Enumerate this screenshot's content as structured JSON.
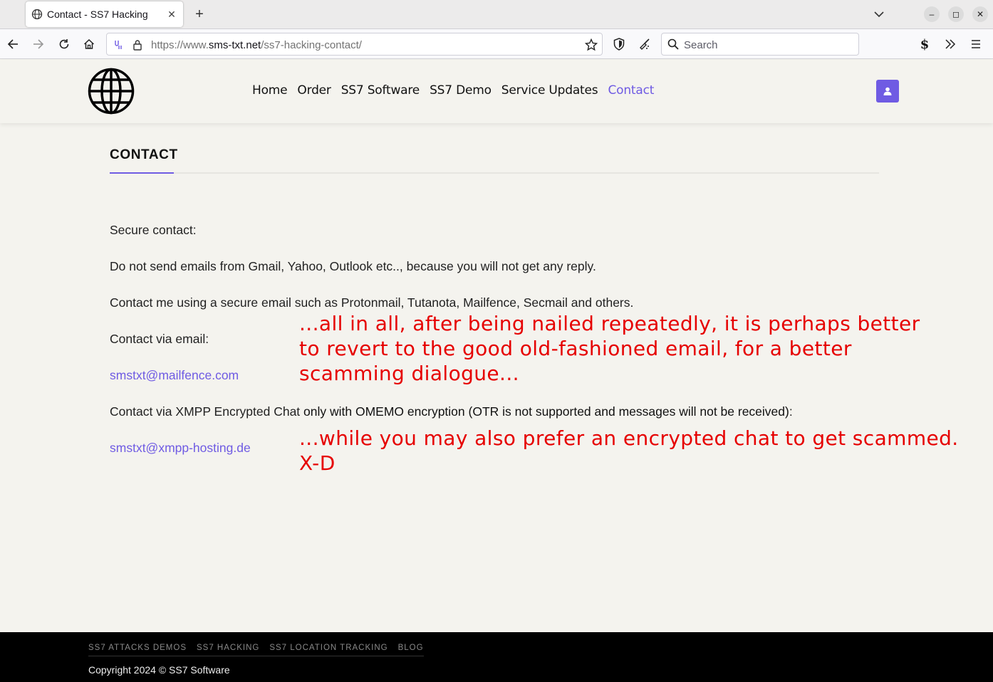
{
  "browser": {
    "tab_title": "Contact - SS7 Hacking",
    "url_prefix": "https://www.",
    "url_host": "sms-txt.net",
    "url_path": "/ss7-hacking-contact/",
    "search_placeholder": "Search",
    "icons": [
      "globe-icon",
      "close-icon",
      "plus-icon",
      "chevron-down-icon",
      "minimize-icon",
      "maximize-icon",
      "window-close-icon",
      "back-icon",
      "forward-icon",
      "reload-icon",
      "home-icon",
      "tracking-icon",
      "lock-icon",
      "star-icon",
      "shield-icon",
      "broom-icon",
      "search-icon",
      "s-extension-icon",
      "overflow-icon",
      "hamburger-icon"
    ]
  },
  "site": {
    "nav": [
      "Home",
      "Order",
      "SS7 Software",
      "SS7 Demo",
      "Service Updates",
      "Contact"
    ],
    "active_nav": "Contact",
    "accent": "#6f5be3"
  },
  "content": {
    "title": "CONTACT",
    "secure_contact": "Secure contact:",
    "no_gmail": "Do not send emails from Gmail, Yahoo, Outlook etc.., because you will not get any reply.",
    "secure_email": "Contact me using a secure email such as Protonmail, Tutanota, Mailfence, Secmail and others.",
    "via_email": "Contact via email:",
    "email": "smstxt@mailfence.com",
    "via_xmpp": "Contact via XMPP Encrypted Chat",
    "xmpp_bold": " only with OMEMO encryption (OTR is not supported and messages will not be received)",
    "xmpp_colon": ":",
    "xmpp": "smstxt@xmpp-hosting.de"
  },
  "annotations": {
    "color": "#e60000",
    "note1_lines": [
      "...all in all, after being nailed repeatedly, it is perhaps better",
      "to revert to the good old-fashioned email, for a better",
      "scamming dialogue..."
    ],
    "note2_lines": [
      "...while you may also prefer an encrypted chat to get scammed.",
      "X-D"
    ]
  },
  "footer": {
    "links": [
      "SS7 ATTACKS DEMOS",
      "SS7 HACKING",
      "SS7 LOCATION TRACKING",
      "BLOG"
    ],
    "copyright_prefix": "Copyright 2024 © ",
    "copyright_brand": "SS7 Software"
  }
}
